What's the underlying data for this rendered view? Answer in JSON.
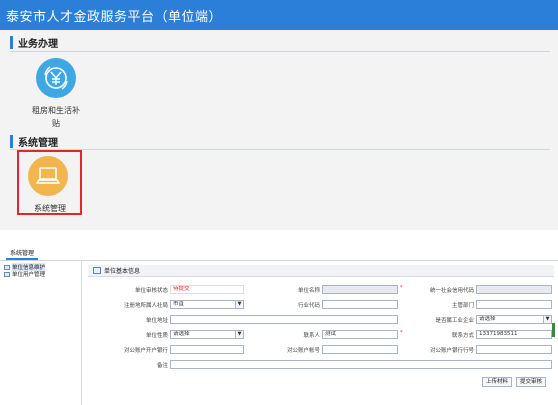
{
  "header": {
    "title": "泰安市人才金政服务平台（单位端）"
  },
  "sections": {
    "business": {
      "title": "业务办理",
      "items": [
        {
          "label_line1": "租房和生活补",
          "label_line2": "贴",
          "icon": "yen-coin-icon"
        }
      ]
    },
    "system": {
      "title": "系统管理",
      "items": [
        {
          "label": "系统管理",
          "icon": "laptop-icon"
        }
      ]
    }
  },
  "window": {
    "tab": "系统管理",
    "tree": [
      {
        "label": "单位信息维护",
        "selected": true
      },
      {
        "label": "单位用户管理",
        "selected": false
      }
    ],
    "form": {
      "title": "单位基本信息",
      "fields": {
        "audit_status": {
          "label": "单位审核状态",
          "value": "待提交"
        },
        "unit_name": {
          "label": "单位名称",
          "value": ""
        },
        "credit_code": {
          "label": "统一社会信用代码",
          "value": ""
        },
        "region": {
          "label": "注册地所属人社局",
          "value": "市直"
        },
        "industry_code": {
          "label": "行业代码",
          "value": ""
        },
        "supervisor": {
          "label": "主管部门",
          "value": ""
        },
        "address": {
          "label": "单位地址",
          "value": ""
        },
        "is_key_enterprise": {
          "label": "是否属工业企业",
          "value": "请选择"
        },
        "unit_nature": {
          "label": "单位性质",
          "value": "请选择"
        },
        "contact": {
          "label": "联系人",
          "value": "测试"
        },
        "phone": {
          "label": "联系方式",
          "value": "13371983511"
        },
        "bank": {
          "label": "对公账户开户银行",
          "value": ""
        },
        "account": {
          "label": "对公账户帐号",
          "value": ""
        },
        "bank_code": {
          "label": "对公账户银行行号",
          "value": ""
        },
        "remark": {
          "label": "备注",
          "value": ""
        }
      },
      "buttons": {
        "upload": "上传材料",
        "submit": "提交审核"
      }
    }
  },
  "colors": {
    "header": "#2b7fd8",
    "highlight": "#e3262b",
    "blue_icon": "#3fa7e3",
    "orange_icon": "#f3b64f"
  }
}
